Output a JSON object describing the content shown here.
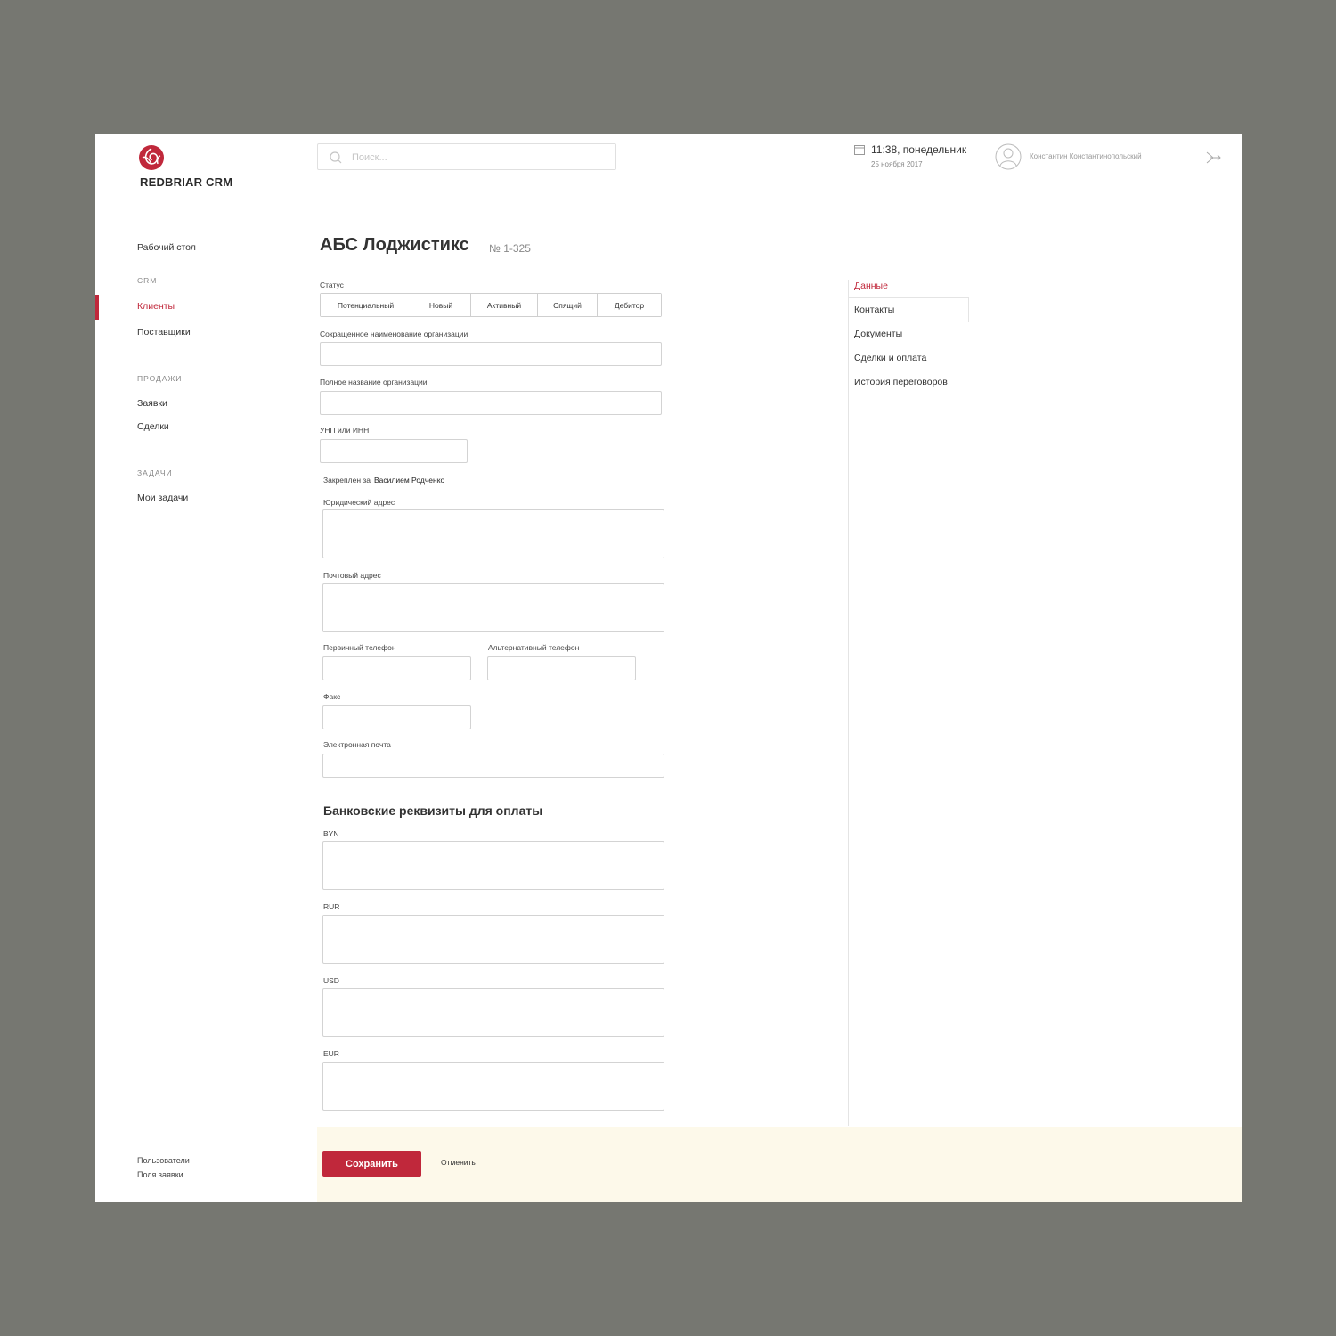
{
  "app": {
    "name": "REDBRIAR CRM",
    "brand_color": "#c0283b"
  },
  "header": {
    "search_placeholder": "Поиск...",
    "time": "11:38, понедельник",
    "date": "25 ноября 2017",
    "user_name": "Константин Константинопольский"
  },
  "sidebar": {
    "dashboard": "Рабочий стол",
    "crm_section": "CRM",
    "clients": "Клиенты",
    "suppliers": "Поставщики",
    "sales_section": "ПРОДАЖИ",
    "requests": "Заявки",
    "deals": "Сделки",
    "tasks_section": "ЗАДАЧИ",
    "my_tasks": "Мои задачи",
    "users": "Пользователи",
    "request_fields": "Поля заявки"
  },
  "page": {
    "title": "АБС Лоджистикс",
    "number": "№ 1-325"
  },
  "form": {
    "status_label": "Статус",
    "status_options": [
      "Потенциальный",
      "Новый",
      "Активный",
      "Спящий",
      "Дебитор"
    ],
    "short_name_label": "Сокращенное наименование организации",
    "short_name_value": "",
    "full_name_label": "Полное название организации",
    "full_name_value": "",
    "tax_id_label": "УНП или ИНН",
    "tax_id_value": "",
    "assigned_label": "Закреплен за",
    "assigned_value": "Василием Родченко",
    "legal_address_label": "Юридический адрес",
    "postal_address_label": "Почтовый адрес",
    "primary_phone_label": "Первичный телефон",
    "alt_phone_label": "Альтернативный телефон",
    "fax_label": "Факс",
    "email_label": "Электронная почта",
    "bank_section_title": "Банковские реквизиты для оплаты",
    "byn_label": "BYN",
    "rur_label": "RUR",
    "usd_label": "USD",
    "eur_label": "EUR"
  },
  "tabs": {
    "data": "Данные",
    "contacts": "Контакты",
    "documents": "Документы",
    "deals_payment": "Сделки и оплата",
    "negotiation_history": "История переговоров"
  },
  "footer": {
    "save": "Сохранить",
    "cancel": "Отменить"
  }
}
